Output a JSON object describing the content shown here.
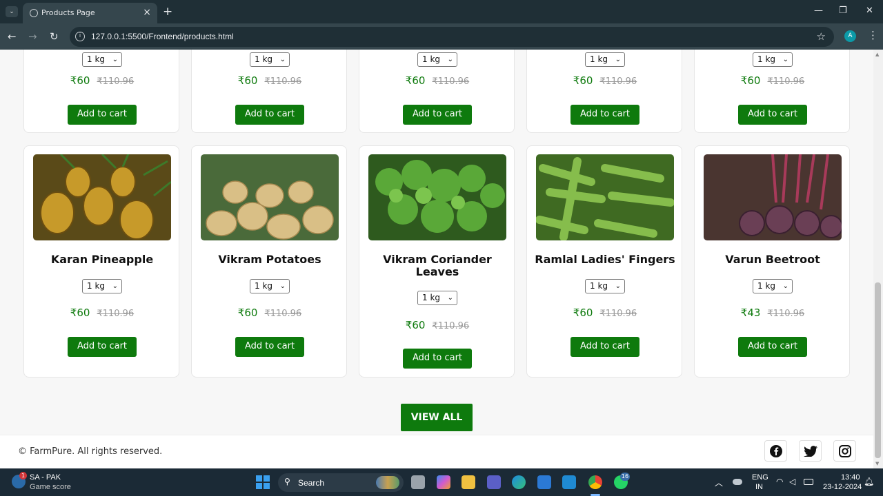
{
  "browser": {
    "tab_title": "Products Page",
    "url": "127.0.0.1:5500/Frontend/products.html",
    "profile_initial": "A"
  },
  "top_row": [
    {
      "qty": "1 kg",
      "price": "₹60",
      "mrp": "₹110.96",
      "button": "Add to cart"
    },
    {
      "qty": "1 kg",
      "price": "₹60",
      "mrp": "₹110.96",
      "button": "Add to cart"
    },
    {
      "qty": "1 kg",
      "price": "₹60",
      "mrp": "₹110.96",
      "button": "Add to cart"
    },
    {
      "qty": "1 kg",
      "price": "₹60",
      "mrp": "₹110.96",
      "button": "Add to cart"
    },
    {
      "qty": "1 kg",
      "price": "₹60",
      "mrp": "₹110.96",
      "button": "Add to cart"
    }
  ],
  "products": [
    {
      "name": "Karan Pineapple",
      "qty": "1 kg",
      "price": "₹60",
      "mrp": "₹110.96",
      "button": "Add to cart",
      "color": "#9c7a1e"
    },
    {
      "name": "Vikram Potatoes",
      "qty": "1 kg",
      "price": "₹60",
      "mrp": "₹110.96",
      "button": "Add to cart",
      "color": "#c9a860"
    },
    {
      "name": "Vikram Coriander Leaves",
      "qty": "1 kg",
      "price": "₹60",
      "mrp": "₹110.96",
      "button": "Add to cart",
      "color": "#3e8a24"
    },
    {
      "name": "Ramlal Ladies' Fingers",
      "qty": "1 kg",
      "price": "₹60",
      "mrp": "₹110.96",
      "button": "Add to cart",
      "color": "#6ca23a"
    },
    {
      "name": "Varun Beetroot",
      "qty": "1 kg",
      "price": "₹43",
      "mrp": "₹110.96",
      "button": "Add to cart",
      "color": "#6a3a44"
    }
  ],
  "view_all": "VIEW ALL",
  "footer": {
    "copyright": "© FarmPure. All rights reserved."
  },
  "taskbar": {
    "widget_title": "SA - PAK",
    "widget_sub": "Game score",
    "widget_badge": "1",
    "search": "Search",
    "lang": "ENG",
    "region": "IN",
    "time": "13:40",
    "date": "23-12-2024",
    "whatsapp_badge": "16"
  },
  "colors": {
    "accent": "#0e7a0d"
  }
}
